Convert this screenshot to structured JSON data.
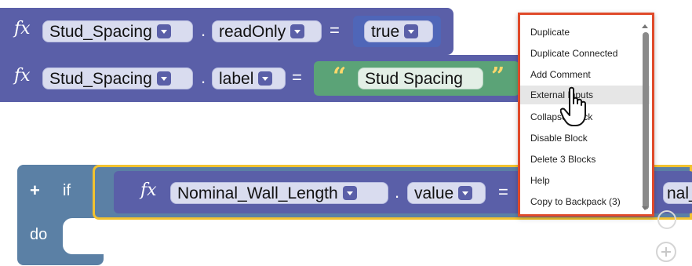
{
  "row1": {
    "fx": "fx",
    "variable": "Stud_Spacing",
    "dot": ".",
    "property": "readOnly",
    "eq": "=",
    "value": "true"
  },
  "row2": {
    "fx": "fx",
    "variable": "Stud_Spacing",
    "dot": ".",
    "property": "label",
    "eq": "=",
    "open_quote": "“",
    "value": "Stud Spacing",
    "close_quote": "”"
  },
  "if_block": {
    "plus": "+",
    "if_label": "if",
    "do_label": "do",
    "fx": "fx",
    "variable": "Nominal_Wall_Length",
    "dot": ".",
    "property": "value",
    "eq": "=",
    "trailing_text": "nal_W"
  },
  "context_menu": {
    "items": [
      "Duplicate",
      "Duplicate Connected",
      "Add Comment",
      "External Inputs",
      "Collapse Block",
      "Disable Block",
      "Delete 3 Blocks",
      "Help",
      "Copy to Backpack (3)"
    ]
  },
  "colors": {
    "procedure_block": "#5a5fa8",
    "if_block": "#5b80a5",
    "highlight_border": "#f2c230",
    "text_block": "#5ba377",
    "menu_outline": "#e04a2a"
  },
  "icons": [
    "hand-pointer-icon",
    "plus-icon",
    "crosshair-icon",
    "zoom-in-icon"
  ]
}
